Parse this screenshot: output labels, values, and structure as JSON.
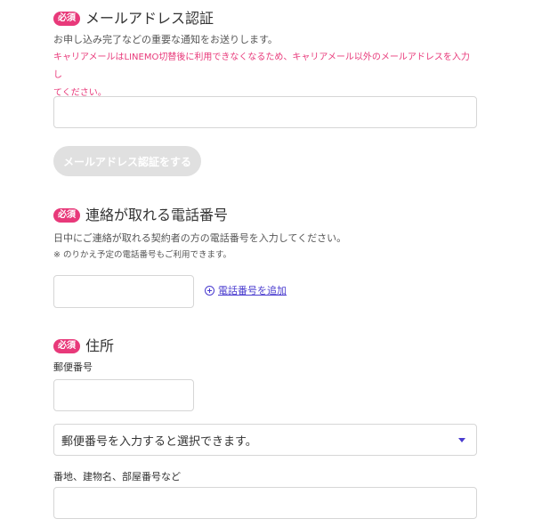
{
  "email_section": {
    "badge": "必須",
    "title": "メールアドレス認証",
    "description": "お申し込み完了などの重要な通知をお送りします。",
    "warning_line1": "キャリアメールはLINEMO切替後に利用できなくなるため、キャリアメール以外のメールアドレスを入力し",
    "warning_line2": "てください。",
    "input_value": "",
    "verify_button": "メールアドレス認証をする"
  },
  "phone_section": {
    "badge": "必須",
    "title": "連絡が取れる電話番号",
    "description": "日中にご連絡が取れる契約者の方の電話番号を入力してください。",
    "note": "※ のりかえ予定の電話番号もご利用できます。",
    "input_value": "",
    "add_link": "電話番号を追加"
  },
  "address_section": {
    "badge": "必須",
    "title": "住所",
    "postal_label": "郵便番号",
    "postal_value": "",
    "prefecture_select": "郵便番号を入力すると選択できます。",
    "street_label": "番地、建物名、部屋番号など",
    "street_value": ""
  },
  "colors": {
    "badge": "#e8397a",
    "warning": "#e8397a",
    "link": "#4a3ccf",
    "disabled_button": "#e0e0e0"
  }
}
